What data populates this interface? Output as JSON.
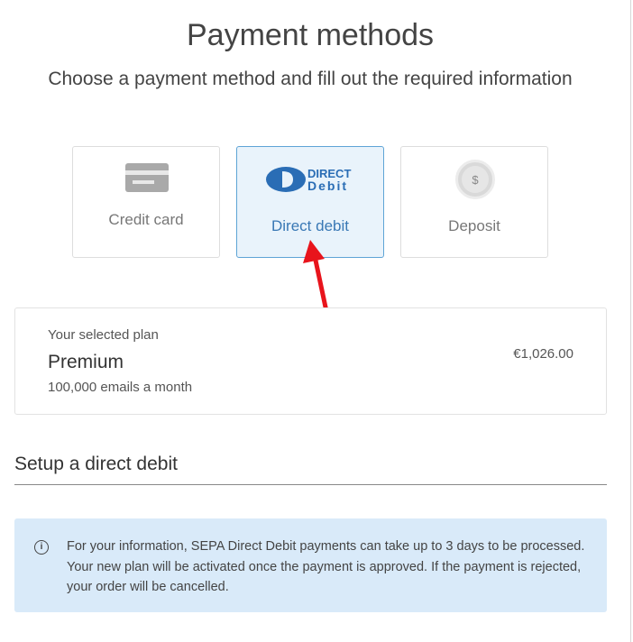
{
  "header": {
    "title": "Payment methods",
    "subtitle": "Choose a payment method and fill out the required information"
  },
  "payment_methods": [
    {
      "label": "Credit card",
      "icon": "credit-card-icon",
      "selected": false
    },
    {
      "label": "Direct debit",
      "icon": "direct-debit-logo",
      "selected": true,
      "logo_text_top": "DIRECT",
      "logo_text_bottom": "Debit"
    },
    {
      "label": "Deposit",
      "icon": "dollar-coin-icon",
      "selected": false,
      "icon_text": "$"
    }
  ],
  "plan": {
    "caption": "Your selected plan",
    "name": "Premium",
    "detail": "100,000 emails a month",
    "price": "€1,026.00"
  },
  "section": {
    "title": "Setup a direct debit"
  },
  "info": {
    "icon": "info-icon",
    "icon_text": "i",
    "text": "For your information, SEPA Direct Debit payments can take up to 3 days to be processed. Your new plan will be activated once the payment is approved. If the payment is rejected, your order will be cancelled."
  },
  "colors": {
    "selected_bg": "#e9f3fb",
    "selected_border": "#5ea4d6",
    "selected_text": "#3978b5",
    "info_bg": "#d9eaf9",
    "arrow": "#e8141c",
    "dd_logo": "#2a6db5"
  }
}
